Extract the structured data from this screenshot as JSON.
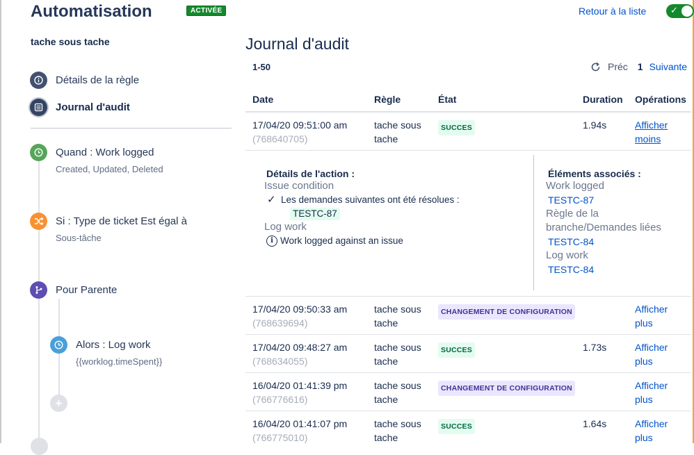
{
  "header": {
    "title": "Automatisation",
    "status_badge": "ACTIVÉE",
    "back_link": "Retour à la liste",
    "toggle_on": true
  },
  "sidebar": {
    "rule_name": "tache sous tache",
    "nav": [
      {
        "label": "Détails de la règle",
        "icon": "info-icon"
      },
      {
        "label": "Journal d'audit",
        "icon": "list-icon"
      }
    ],
    "steps": [
      {
        "title": "Quand : Work logged",
        "sub": "Created, Updated, Deleted",
        "icon": "clock-icon",
        "color": "#57a55a"
      },
      {
        "title": "Si : Type de ticket Est égal à",
        "sub": "Sous-tâche",
        "icon": "shuffle-icon",
        "color": "#f79232"
      },
      {
        "title": "Pour Parente",
        "sub": "",
        "icon": "branch-icon",
        "color": "#5e4db2"
      },
      {
        "title": "Alors : Log work",
        "sub": "{{worklog.timeSpent}}",
        "icon": "clock-icon",
        "color": "#4a9fd8"
      }
    ]
  },
  "main": {
    "title": "Journal d'audit",
    "range": "1-50",
    "pager": {
      "prev": "Préc",
      "page": "1",
      "next": "Suivante"
    },
    "columns": [
      "Date",
      "Règle",
      "État",
      "Duration",
      "Opérations"
    ],
    "rows": [
      {
        "date": "17/04/20 09:51:00 am",
        "id": "(768640705)",
        "rule1": "tache sous",
        "rule2": "tache",
        "state": "SUCCES",
        "duration": "1.94s",
        "op1": "Afficher",
        "op2": "moins"
      },
      {
        "date": "17/04/20 09:50:33 am",
        "id": "(768639694)",
        "rule1": "tache sous",
        "rule2": "tache",
        "state": "CHANGEMENT DE CONFIGURATION",
        "duration": "",
        "op1": "Afficher",
        "op2": "plus"
      },
      {
        "date": "17/04/20 09:48:27 am",
        "id": "(768634055)",
        "rule1": "tache sous",
        "rule2": "tache",
        "state": "SUCCES",
        "duration": "1.73s",
        "op1": "Afficher",
        "op2": "plus"
      },
      {
        "date": "16/04/20 01:41:39 pm",
        "id": "(766776616)",
        "rule1": "tache sous",
        "rule2": "tache",
        "state": "CHANGEMENT DE CONFIGURATION",
        "duration": "",
        "op1": "Afficher",
        "op2": "plus"
      },
      {
        "date": "16/04/20 01:41:07 pm",
        "id": "(766775010)",
        "rule1": "tache sous",
        "rule2": "tache",
        "state": "SUCCES",
        "duration": "1.64s",
        "op1": "Afficher",
        "op2": "plus"
      }
    ],
    "details": {
      "action_heading": "Détails de l'action :",
      "issue_condition": "Issue condition",
      "resolved_text": "Les demandes suivantes ont été résolues :",
      "resolved_key": "TESTC-87",
      "log_work": "Log work",
      "log_work_text": "Work logged against an issue",
      "assoc_heading": "Éléments associés :",
      "assoc": [
        {
          "label": "Work logged",
          "link": "TESTC-87"
        },
        {
          "label1": "Règle de la",
          "label2": "branche/Demandes liées",
          "link": "TESTC-84"
        },
        {
          "label": "Log work",
          "link": "TESTC-84"
        }
      ]
    }
  }
}
